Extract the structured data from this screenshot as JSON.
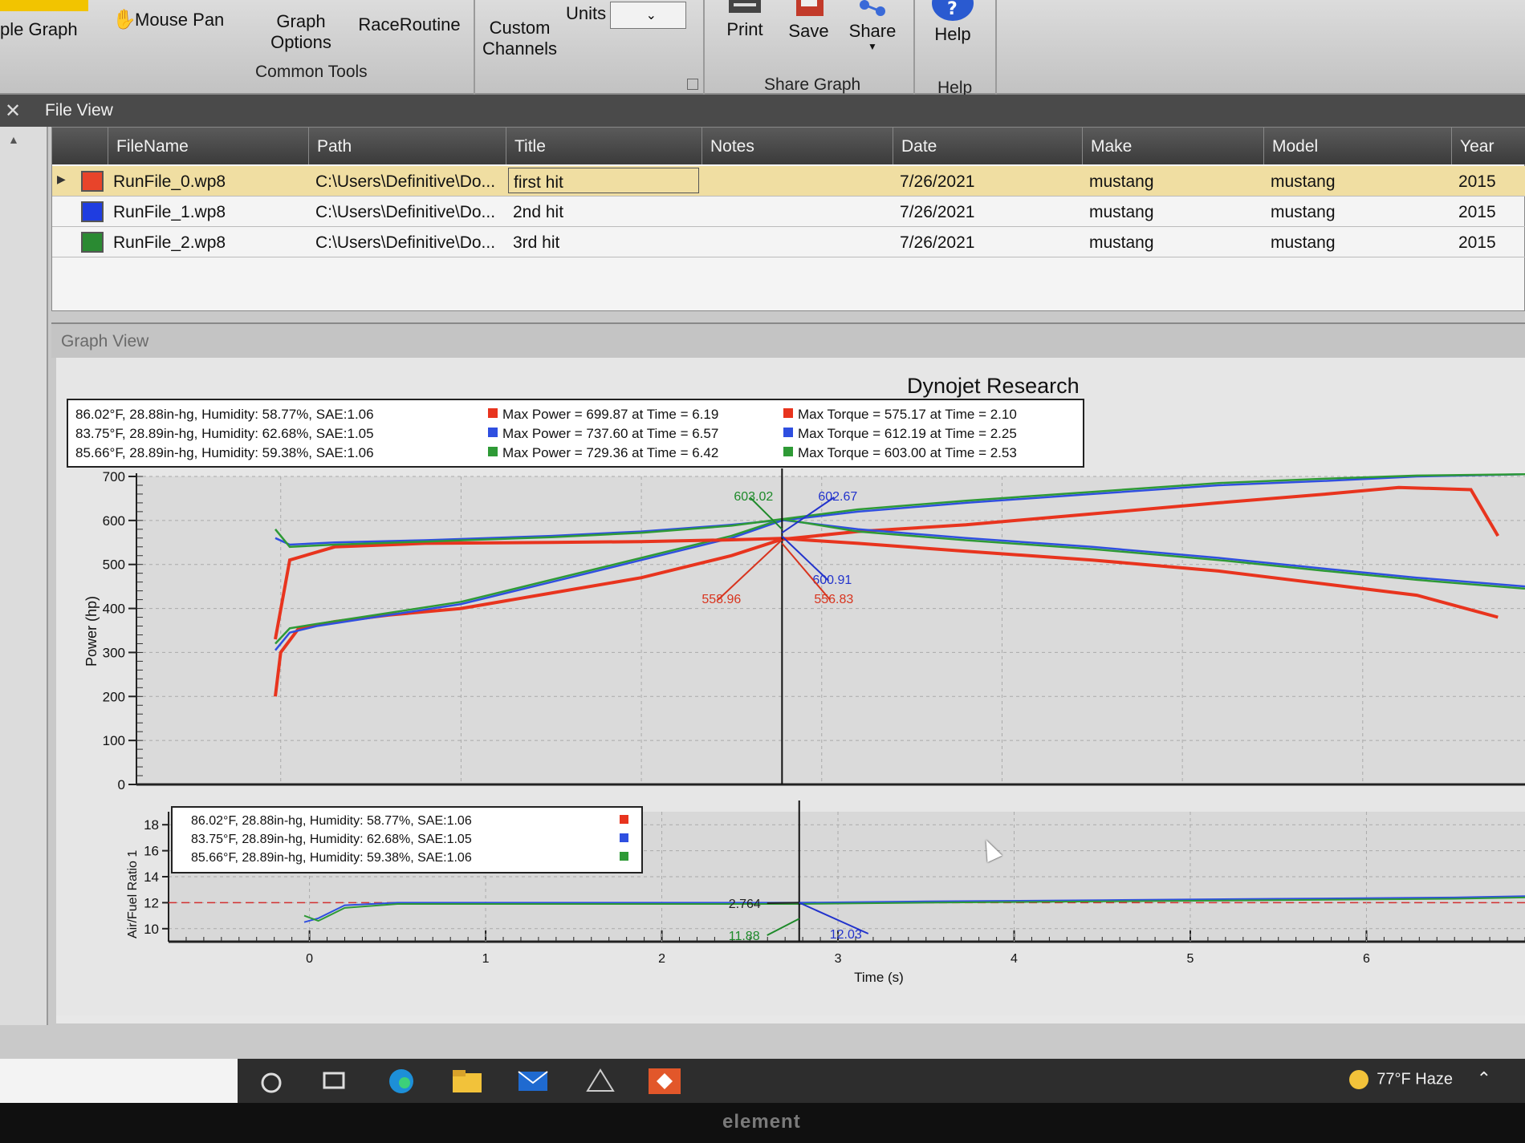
{
  "ribbon": {
    "simple_graph": "ple Graph",
    "mouse_pan": "Mouse Pan",
    "graph_options_1": "Graph",
    "graph_options_2": "Options",
    "race_routine": "RaceRoutine",
    "custom_channels_1": "Custom",
    "custom_channels_2": "Channels",
    "units_label": "Units",
    "common_tools": "Common Tools",
    "print": "Print",
    "save": "Save",
    "share": "Share",
    "share_graph": "Share Graph",
    "help": "Help",
    "help_group": "Help"
  },
  "file_view": {
    "title": "File View",
    "columns": [
      "FileName",
      "Path",
      "Title",
      "Notes",
      "Date",
      "Make",
      "Model",
      "Year"
    ],
    "rows": [
      {
        "color": "#e8442a",
        "filename": "RunFile_0.wp8",
        "path": "C:\\Users\\Definitive\\Do...",
        "title": "first hit",
        "notes": "",
        "date": "7/26/2021",
        "make": "mustang",
        "model": "mustang",
        "year": "2015"
      },
      {
        "color": "#1f3de0",
        "filename": "RunFile_1.wp8",
        "path": "C:\\Users\\Definitive\\Do...",
        "title": "2nd  hit",
        "notes": "",
        "date": "7/26/2021",
        "make": "mustang",
        "model": "mustang",
        "year": "2015"
      },
      {
        "color": "#2a8a32",
        "filename": "RunFile_2.wp8",
        "path": "C:\\Users\\Definitive\\Do...",
        "title": "3rd  hit",
        "notes": "",
        "date": "7/26/2021",
        "make": "mustang",
        "model": "mustang",
        "year": "2015"
      }
    ]
  },
  "graph_view": {
    "title": "Graph View"
  },
  "chart_data": [
    {
      "type": "line",
      "title": "Dynojet Research",
      "xlabel": "",
      "ylabel": "Power (hp)",
      "ylim": [
        0,
        700
      ],
      "xlim": [
        -0.8,
        6.9
      ],
      "yticks": [
        0,
        100,
        200,
        300,
        400,
        500,
        600,
        700
      ],
      "grid": true,
      "cursor_x": 2.78,
      "conditions": [
        "86.02°F, 28.88in-hg, Humidity: 58.77%, SAE:1.06",
        "83.75°F, 28.89in-hg, Humidity: 62.68%, SAE:1.05",
        "85.66°F, 28.89in-hg, Humidity: 59.38%, SAE:1.06"
      ],
      "max_power": [
        "Max Power = 699.87 at Time = 6.19",
        "Max Power = 737.60 at Time = 6.57",
        "Max Power = 729.36 at Time = 6.42"
      ],
      "max_torque": [
        "Max Torque = 575.17 at Time = 2.10",
        "Max Torque = 612.19 at Time = 2.25",
        "Max Torque = 603.00 at Time = 2.53"
      ],
      "cursor_labels": [
        {
          "text": "603.02",
          "color": "#1e8a2a"
        },
        {
          "text": "602.67",
          "color": "#2233cc"
        },
        {
          "text": "600.91",
          "color": "#2233cc"
        },
        {
          "text": "558.96",
          "color": "#d8341e"
        },
        {
          "text": "556.83",
          "color": "#d8341e"
        }
      ],
      "series": [
        {
          "color": "#e8341e",
          "kind": "power",
          "x": [
            -0.03,
            0.0,
            0.1,
            0.3,
            0.6,
            1.0,
            1.5,
            2.0,
            2.5,
            2.78,
            3.2,
            3.8,
            4.5,
            5.2,
            5.8,
            6.2,
            6.6,
            6.75
          ],
          "y": [
            200,
            300,
            355,
            370,
            385,
            400,
            435,
            470,
            520,
            557,
            575,
            590,
            615,
            640,
            660,
            675,
            670,
            565
          ]
        },
        {
          "color": "#2f4fe0",
          "kind": "power",
          "x": [
            -0.03,
            0.05,
            0.2,
            0.6,
            1.0,
            1.5,
            2.0,
            2.5,
            2.78,
            3.2,
            3.8,
            4.5,
            5.2,
            5.8,
            6.3,
            6.9
          ],
          "y": [
            305,
            345,
            360,
            385,
            410,
            460,
            510,
            560,
            600,
            620,
            640,
            660,
            680,
            690,
            700,
            705
          ]
        },
        {
          "color": "#2e9a36",
          "kind": "power",
          "x": [
            -0.03,
            0.05,
            0.2,
            0.6,
            1.0,
            1.5,
            2.0,
            2.5,
            2.78,
            3.2,
            3.8,
            4.5,
            5.2,
            5.8,
            6.3,
            6.9
          ],
          "y": [
            320,
            355,
            365,
            390,
            415,
            465,
            515,
            565,
            603,
            625,
            645,
            665,
            685,
            695,
            702,
            705
          ]
        },
        {
          "color": "#e8341e",
          "kind": "torque",
          "x": [
            -0.03,
            0.05,
            0.3,
            0.8,
            1.5,
            2.0,
            2.5,
            2.78,
            3.2,
            3.8,
            4.5,
            5.2,
            5.8,
            6.3,
            6.75
          ],
          "y": [
            330,
            510,
            540,
            548,
            550,
            552,
            556,
            559,
            548,
            530,
            510,
            485,
            455,
            430,
            380
          ]
        },
        {
          "color": "#2f4fe0",
          "kind": "torque",
          "x": [
            -0.03,
            0.05,
            0.3,
            0.8,
            1.5,
            2.0,
            2.5,
            2.78,
            3.2,
            3.8,
            4.5,
            5.2,
            5.8,
            6.3,
            6.9
          ],
          "y": [
            560,
            545,
            550,
            555,
            565,
            575,
            590,
            601,
            580,
            560,
            540,
            515,
            490,
            470,
            450
          ]
        },
        {
          "color": "#2e9a36",
          "kind": "torque",
          "x": [
            -0.03,
            0.05,
            0.3,
            0.8,
            1.5,
            2.0,
            2.5,
            2.78,
            3.2,
            3.8,
            4.5,
            5.2,
            5.8,
            6.3,
            6.9
          ],
          "y": [
            580,
            540,
            545,
            552,
            562,
            572,
            588,
            603,
            575,
            555,
            535,
            510,
            485,
            465,
            445
          ]
        }
      ]
    },
    {
      "type": "line",
      "title": "",
      "xlabel": "Time (s)",
      "ylabel": "Air/Fuel Ratio 1",
      "ylim": [
        9,
        19
      ],
      "xlim": [
        -0.8,
        6.9
      ],
      "yticks": [
        10,
        12,
        14,
        16,
        18
      ],
      "xticks": [
        0,
        1,
        2,
        3,
        4,
        5,
        6
      ],
      "reference_line": 12,
      "conditions": [
        "86.02°F, 28.88in-hg, Humidity: 58.77%, SAE:1.06",
        "83.75°F, 28.89in-hg, Humidity: 62.68%, SAE:1.05",
        "85.66°F, 28.89in-hg, Humidity: 59.38%, SAE:1.06"
      ],
      "legend_colors": [
        "#e8341e",
        "#2f4fe0",
        "#2e9a36"
      ],
      "cursor_labels": [
        {
          "text": "2.764",
          "color": "#222222"
        },
        {
          "text": "11.88",
          "color": "#1e8a2a"
        },
        {
          "text": "12.03",
          "color": "#2233cc"
        }
      ],
      "series": [
        {
          "color": "#2f4fe0",
          "x": [
            -0.03,
            0.05,
            0.2,
            0.5,
            1.0,
            2.0,
            2.78,
            3.5,
            4.5,
            5.5,
            6.5,
            6.9
          ],
          "y": [
            10.5,
            10.8,
            11.8,
            12.0,
            12.0,
            12.0,
            12.0,
            12.1,
            12.2,
            12.3,
            12.4,
            12.5
          ]
        },
        {
          "color": "#2e9a36",
          "x": [
            -0.03,
            0.05,
            0.2,
            0.5,
            1.0,
            2.0,
            2.78,
            3.5,
            4.5,
            5.5,
            6.5,
            6.9
          ],
          "y": [
            11.0,
            10.6,
            11.6,
            11.9,
            11.9,
            11.9,
            11.9,
            12.0,
            12.1,
            12.2,
            12.3,
            12.4
          ]
        }
      ]
    }
  ],
  "taskbar": {
    "weather": "77°F  Haze"
  },
  "bezel": {
    "brand": "element"
  }
}
